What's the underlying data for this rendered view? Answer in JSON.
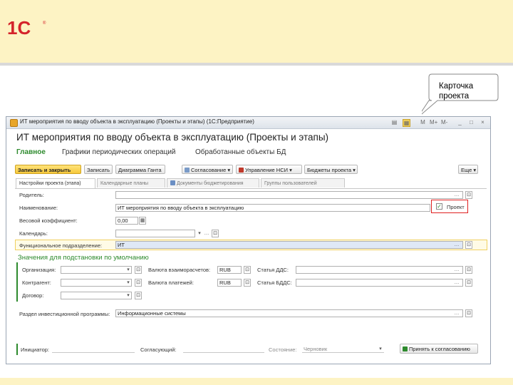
{
  "slide": {
    "callout_text": "Карточка\nпроекта",
    "brand": "1С"
  },
  "window": {
    "title": "ИТ мероприятия по вводу объекта в эксплуатацию (Проекты и этапы)  (1С:Предприятие)",
    "heading": "ИТ мероприятия по вводу объекта в эксплуатацию (Проекты и этапы)",
    "controls": [
      "М",
      "М+",
      "М-",
      "_",
      "□",
      "×"
    ]
  },
  "nav_tabs": [
    "Главное",
    "Графики периодических операций",
    "Обработанные объекты БД"
  ],
  "toolbar": {
    "save_close": "Записать и закрыть",
    "save": "Записать",
    "gantt": "Диаграмма Ганта",
    "approvals": "Согласование",
    "nsi": "Управление НСИ",
    "budgets": "Бюджеты проекта",
    "more": "Еще"
  },
  "tabs": [
    "Настройки проекта (этапа)",
    "Календарные планы",
    "Документы бюджетирования",
    "Группы пользователей"
  ],
  "form": {
    "parent_label": "Родитель:",
    "name_label": "Наименование:",
    "name_value": "ИТ мероприятия по вводу объекта в эксплуатацию",
    "project_checkbox_label": "Проект",
    "weight_label": "Весовой коэффициент:",
    "weight_value": "0,00",
    "calendar_label": "Календарь:",
    "dept_label": "Функциональное подразделение:",
    "dept_value": "ИТ",
    "group_title": "Значения для подстановки по умолчанию",
    "org_label": "Организация:",
    "currency_mutual_label": "Валюта взаиморасчетов:",
    "currency_mutual_value": "RUB",
    "dds_label": "Статья ДДС:",
    "counterparty_label": "Контрагент:",
    "currency_payment_label": "Валюта платежей:",
    "currency_payment_value": "RUB",
    "bdr_label": "Статья БДДС:",
    "contract_label": "Договор:",
    "invest_label": "Раздел инвестиционной программы:",
    "invest_value": "Информационные системы"
  },
  "footer": {
    "initiator_label": "Инициатор:",
    "approver_label": "Согласующий:",
    "status_label": "Состояние:",
    "status_value": "Черновик",
    "accept_label": "Принять к согласованию"
  }
}
